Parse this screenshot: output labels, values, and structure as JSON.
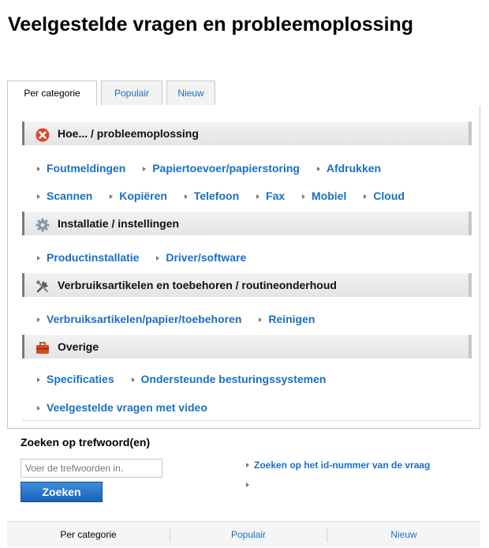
{
  "page": {
    "title": "Veelgestelde vragen en probleemoplossing"
  },
  "tabs": [
    {
      "label": "Per categorie",
      "active": true
    },
    {
      "label": "Populair",
      "active": false
    },
    {
      "label": "Nieuw",
      "active": false
    }
  ],
  "sections": [
    {
      "title": "Hoe... / probleemoplossing",
      "icon": "error-circle-icon",
      "rows": [
        [
          "Foutmeldingen",
          "Papiertoevoer/papierstoring",
          "Afdrukken"
        ],
        [
          "Scannen",
          "Kopiëren",
          "Telefoon",
          "Fax",
          "Mobiel",
          "Cloud"
        ]
      ]
    },
    {
      "title": "Installatie / instellingen",
      "icon": "gear-icon",
      "rows": [
        [
          "Productinstallatie",
          "Driver/software"
        ]
      ]
    },
    {
      "title": "Verbruiksartikelen en toebehoren / routineonderhoud",
      "icon": "tools-icon",
      "rows": [
        [
          "Verbruiksartikelen/papier/toebehoren",
          "Reinigen"
        ]
      ]
    },
    {
      "title": "Overige",
      "icon": "toolbox-icon",
      "rows": [
        [
          "Specificaties",
          "Ondersteunde besturingssystemen"
        ],
        [
          "Veelgestelde vragen met video"
        ]
      ]
    }
  ],
  "search": {
    "title": "Zoeken op trefwoord(en)",
    "placeholder": "Voer de trefwoorden in.",
    "button_label": "Zoeken",
    "id_link": "Zoeken op het id-nummer van de vraag"
  },
  "bottom_tabs": [
    {
      "label": "Per categorie",
      "active": true
    },
    {
      "label": "Populair",
      "active": false
    },
    {
      "label": "Nieuw",
      "active": false
    }
  ],
  "colors": {
    "link": "#1a6fc2",
    "button": "#1f6fc6",
    "error_icon": "#e0452f",
    "toolbox_icon": "#d24a1e"
  }
}
